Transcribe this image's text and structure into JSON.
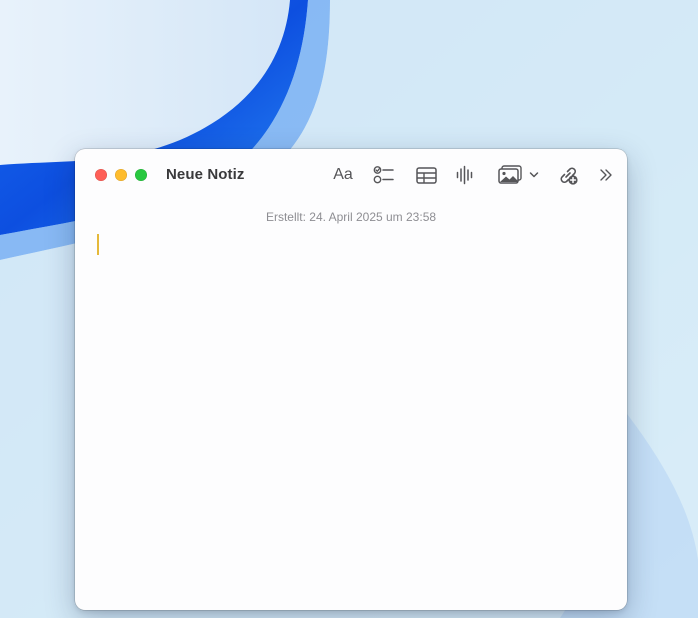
{
  "window": {
    "title": "Neue Notiz",
    "created_label": "Erstellt: 24. April 2025 um 23:58"
  },
  "toolbar": {
    "format_label": "Aa",
    "items": [
      {
        "name": "format",
        "icon": "format-text-icon"
      },
      {
        "name": "checklist",
        "icon": "checklist-icon"
      },
      {
        "name": "table",
        "icon": "table-icon"
      },
      {
        "name": "audio",
        "icon": "waveform-icon"
      },
      {
        "name": "media",
        "icon": "photo-icon"
      },
      {
        "name": "link",
        "icon": "link-add-icon"
      },
      {
        "name": "more",
        "icon": "chevron-double-right-icon"
      }
    ]
  },
  "traffic_lights": {
    "close": "#fe5f57",
    "minimize": "#febc2e",
    "maximize": "#28c840"
  },
  "colors": {
    "caret": "#e5b93a",
    "accent_wallpaper": "#0a5cf0"
  }
}
